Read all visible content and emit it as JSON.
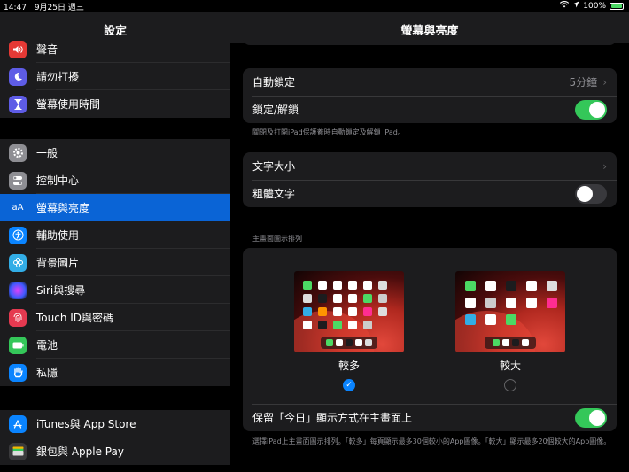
{
  "status": {
    "time": "14:47",
    "date": "9月25日 週三",
    "battery": "100%"
  },
  "sidebar": {
    "title": "設定",
    "groups": [
      {
        "items": [
          {
            "label": "聲音",
            "icon": "speaker-icon",
            "color": "#e53935"
          },
          {
            "label": "請勿打擾",
            "icon": "moon-icon",
            "color": "#5e5ce6"
          },
          {
            "label": "螢幕使用時間",
            "icon": "hourglass-icon",
            "color": "#5e5ce6"
          }
        ]
      },
      {
        "items": [
          {
            "label": "一般",
            "icon": "gear-icon",
            "color": "#8e8e93"
          },
          {
            "label": "控制中心",
            "icon": "switches-icon",
            "color": "#8e8e93"
          },
          {
            "label": "螢幕與亮度",
            "icon": "text-size-icon",
            "color": "#0a64d6"
          },
          {
            "label": "輔助使用",
            "icon": "accessibility-icon",
            "color": "#0a84ff"
          },
          {
            "label": "背景圖片",
            "icon": "flower-icon",
            "color": "#32ade6"
          },
          {
            "label": "Siri與搜尋",
            "icon": "siri-icon",
            "color": "#2c2c2e"
          },
          {
            "label": "Touch ID與密碼",
            "icon": "fingerprint-icon",
            "color": "#e53950"
          },
          {
            "label": "電池",
            "icon": "battery-icon",
            "color": "#34c759"
          },
          {
            "label": "私隱",
            "icon": "hand-icon",
            "color": "#0a84ff"
          }
        ]
      },
      {
        "items": [
          {
            "label": "iTunes與 App Store",
            "icon": "app-store-icon",
            "color": "#0a84ff"
          },
          {
            "label": "銀包與 Apple Pay",
            "icon": "wallet-icon",
            "color": "#2c2c2e"
          }
        ]
      }
    ]
  },
  "main": {
    "title": "螢幕與亮度",
    "auto_lock": {
      "label": "自動鎖定",
      "value": "5分鐘"
    },
    "lock_unlock": {
      "label": "鎖定/解鎖",
      "on": true
    },
    "lock_note": "關閉及打開iPad保護蓋時自動鎖定及解鎖 iPad。",
    "text_size": {
      "label": "文字大小"
    },
    "bold_text": {
      "label": "粗體文字",
      "on": false
    },
    "layout_header": "主畫面圖示排列",
    "layout_more": {
      "label": "較多",
      "selected": true
    },
    "layout_bigger": {
      "label": "較大",
      "selected": false
    },
    "keep_today": {
      "label": "保留「今日」顯示方式在主畫面上",
      "on": true
    },
    "layout_note": "選擇iPad上主畫面圖示排列。「較多」每頁顯示最多30個較小的App圖像。「較大」顯示最多20個較大的App圖像。"
  }
}
